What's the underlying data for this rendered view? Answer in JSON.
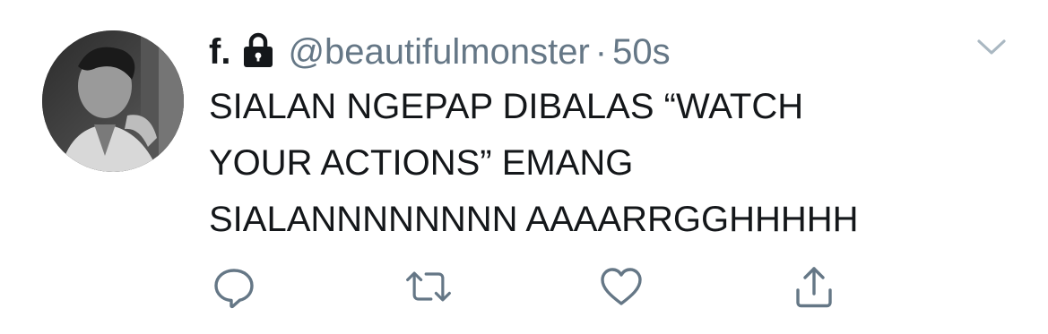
{
  "tweet": {
    "display_name": "f.",
    "handle": "@beautifulmonster",
    "separator": "·",
    "timestamp": "50s",
    "text_lines": [
      "SIALAN NGEPAP DIBALAS “WATCH",
      "YOUR ACTIONS” EMANG",
      "SIALANNNNNNNN AAAARRGGHHHHH"
    ],
    "protected": true
  },
  "icons": {
    "lock": "lock-icon",
    "menu": "chevron-down-icon",
    "reply": "reply-icon",
    "retweet": "retweet-icon",
    "like": "heart-icon",
    "share": "share-icon"
  },
  "colors": {
    "text_primary": "#14171a",
    "text_secondary": "#657786",
    "icon_gray": "#657786",
    "caret_gray": "#aab8c2",
    "background": "#ffffff"
  }
}
